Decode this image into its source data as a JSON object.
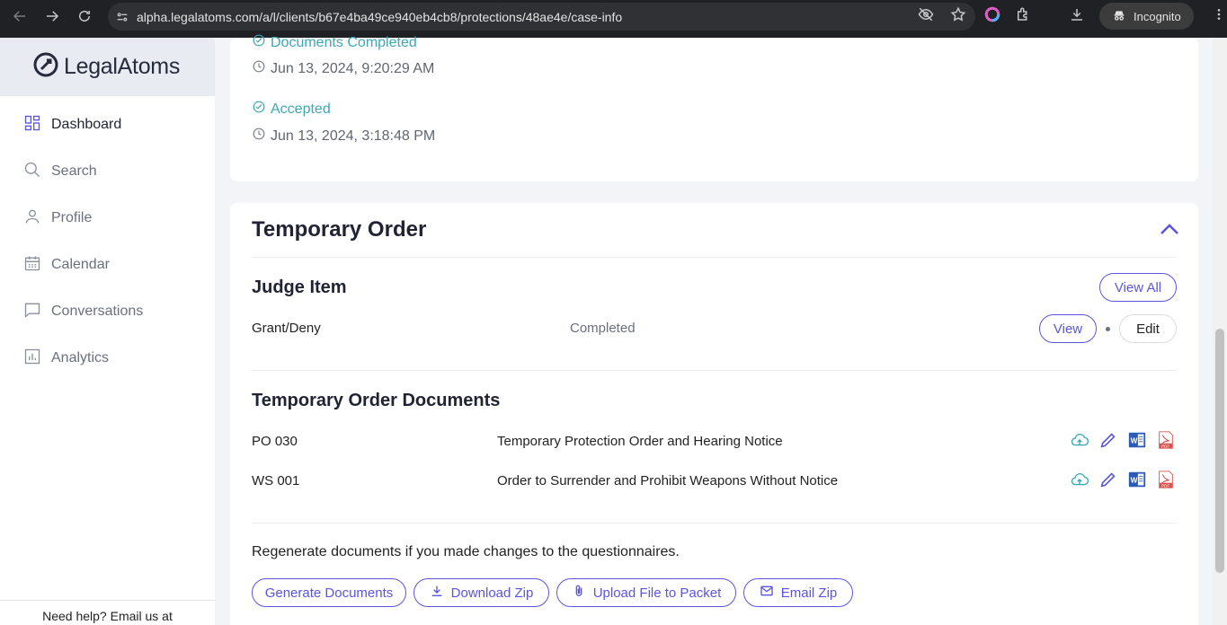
{
  "browser": {
    "url": "alpha.legalatoms.com/a/l/clients/b67e4ba49ce940eb4cb8/protections/48ae4e/case-info",
    "incognito_label": "Incognito"
  },
  "sidebar": {
    "logo_text": "LegalAtoms",
    "items": [
      {
        "label": "Dashboard",
        "icon": "dashboard-icon"
      },
      {
        "label": "Search",
        "icon": "search-icon"
      },
      {
        "label": "Profile",
        "icon": "profile-icon"
      },
      {
        "label": "Calendar",
        "icon": "calendar-icon"
      },
      {
        "label": "Conversations",
        "icon": "chat-icon"
      },
      {
        "label": "Analytics",
        "icon": "analytics-icon"
      }
    ],
    "help_text": "Need help? Email us at"
  },
  "history": [
    {
      "status": "Documents Completed",
      "timestamp": "Jun 13, 2024, 9:20:29 AM"
    },
    {
      "status": "Accepted",
      "timestamp": "Jun 13, 2024, 3:18:48 PM"
    }
  ],
  "temporary_order": {
    "title": "Temporary Order",
    "judge_item": {
      "title": "Judge Item",
      "view_all_label": "View All",
      "row": {
        "name": "Grant/Deny",
        "status": "Completed",
        "view_label": "View",
        "edit_label": "Edit"
      }
    },
    "documents": {
      "title": "Temporary Order Documents",
      "rows": [
        {
          "code": "PO 030",
          "name": "Temporary Protection Order and Hearing Notice"
        },
        {
          "code": "WS 001",
          "name": "Order to Surrender and Prohibit Weapons Without Notice"
        }
      ]
    },
    "regenerate_text": "Regenerate documents if you made changes to the questionnaires.",
    "actions": {
      "generate": "Generate Documents",
      "download": "Download Zip",
      "upload": "Upload File to Packet",
      "email": "Email Zip"
    }
  },
  "colors": {
    "accent": "#5a55e0",
    "teal": "#3ba8b5",
    "word_blue": "#2b5cb8",
    "pdf_red": "#d9534f"
  }
}
